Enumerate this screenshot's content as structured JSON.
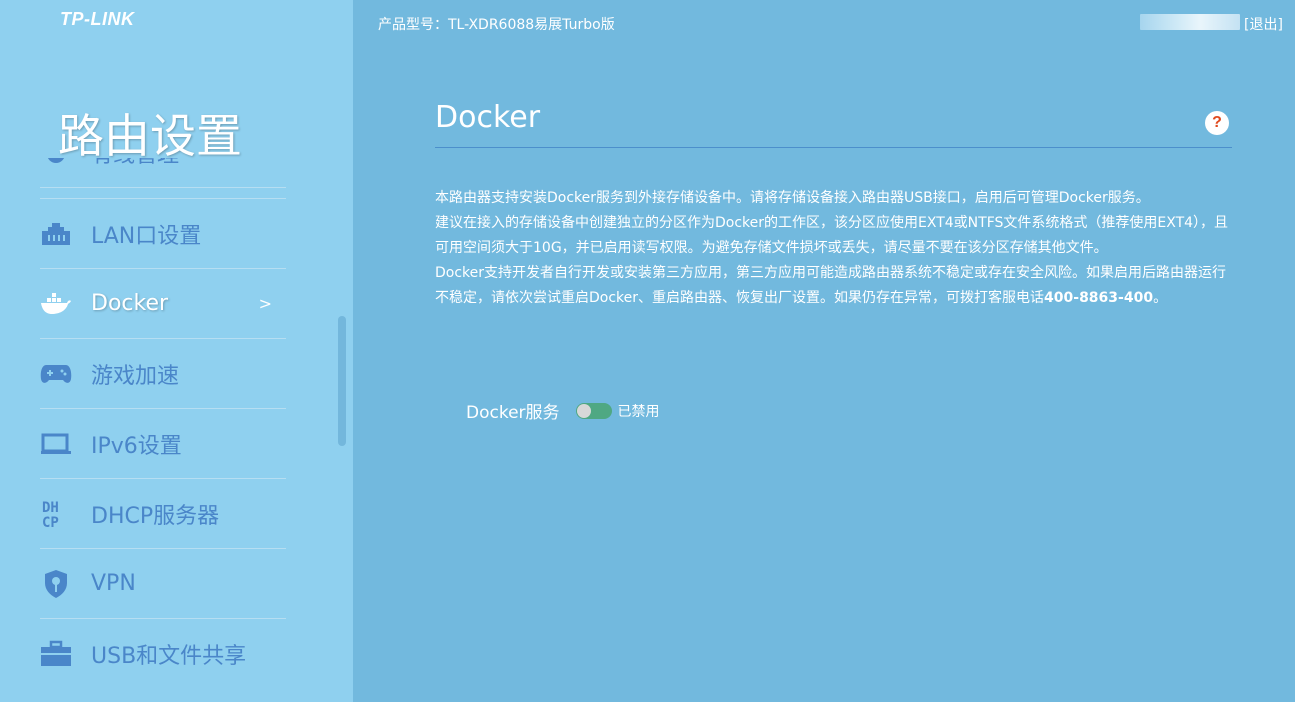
{
  "brand": {
    "logo": "TP-LINK"
  },
  "header": {
    "product": "产品型号：TL-XDR6088易展Turbo版",
    "logout": "[退出]"
  },
  "sidebar": {
    "title": "路由设置",
    "items": [
      {
        "label": "有线管理",
        "icon": "partial-icon",
        "active": false
      },
      {
        "label": "LAN口设置",
        "icon": "ethernet-port-icon",
        "active": false
      },
      {
        "label": "Docker",
        "icon": "docker-whale-icon",
        "active": true,
        "arrow": ">"
      },
      {
        "label": "游戏加速",
        "icon": "gamepad-icon",
        "active": false
      },
      {
        "label": "IPv6设置",
        "icon": "monitor-icon",
        "active": false
      },
      {
        "label": "DHCP服务器",
        "icon": "dhcp-icon",
        "active": false
      },
      {
        "label": "VPN",
        "icon": "shield-key-icon",
        "active": false
      },
      {
        "label": "USB和文件共享",
        "icon": "briefcase-icon",
        "active": false
      }
    ]
  },
  "main": {
    "title": "Docker",
    "help": "?",
    "desc": {
      "p1": "本路由器支持安装Docker服务到外接存储设备中。请将存储设备接入路由器USB接口，启用后可管理Docker服务。",
      "p2": "建议在接入的存储设备中创建独立的分区作为Docker的工作区，该分区应使用EXT4或NTFS文件系统格式（推荐使用EXT4），且可用空间须大于10G，并已启用读写权限。为避免存储文件损坏或丢失，请尽量不要在该分区存储其他文件。",
      "p3": "Docker支持开发者自行开发或安装第三方应用，第三方应用可能造成路由器系统不稳定或存在安全风险。如果启用后路由器运行不稳定，请依次尝试重启Docker、重启路由器、恢复出厂设置。如果仍存在异常，可拨打客服电话",
      "phone": "400-8863-400",
      "p3_end": "。"
    },
    "service": {
      "label": "Docker服务",
      "status": "已禁用",
      "enabled": false
    }
  },
  "colors": {
    "sidebar_bg": "#8fd0ef",
    "main_bg": "#72b9de",
    "nav_text": "#4a86c9",
    "toggle": "#4fa883"
  }
}
